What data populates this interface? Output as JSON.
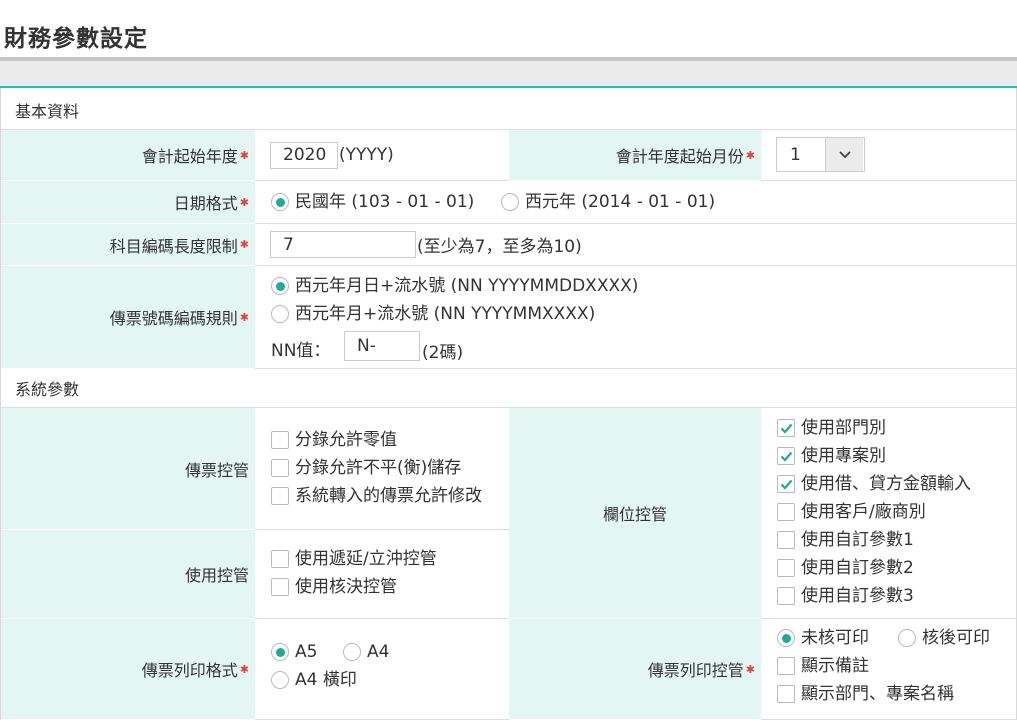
{
  "page_title": "財務參數設定",
  "sections": {
    "basic": "基本資料",
    "system": "系統參數"
  },
  "fiscal_start_year": {
    "label": "會計起始年度",
    "value": "2020",
    "suffix": "(YYYY)"
  },
  "fiscal_start_month": {
    "label": "會計年度起始月份",
    "value": "1"
  },
  "date_format": {
    "label": "日期格式",
    "opt1": "民國年 (103 - 01 - 01)",
    "opt2": "西元年 (2014 - 01 - 01)",
    "selected": "opt1"
  },
  "account_code_length": {
    "label": "科目編碼長度限制",
    "value": "7",
    "hint": "(至少為7，至多為10)"
  },
  "voucher_number_rule": {
    "label": "傳票號碼編碼規則",
    "opt1": "西元年月日+流水號 (NN YYYYMMDDXXXX)",
    "opt2": "西元年月+流水號 (NN YYYYMMXXXX)",
    "nn_label": "NN值：",
    "nn_value": "N-",
    "nn_hint": "(2碼)",
    "selected": "opt1"
  },
  "voucher_control": {
    "label": "傳票控管",
    "opt1": "分錄允許零值",
    "opt2": "分錄允許不平(衡)儲存",
    "opt3": "系統轉入的傳票允許修改"
  },
  "usage_control": {
    "label": "使用控管",
    "opt1": "使用遞延/立沖控管",
    "opt2": "使用核決控管"
  },
  "field_control": {
    "label": "欄位控管",
    "opt1": "使用部門別",
    "opt2": "使用專案別",
    "opt3": "使用借、貸方金額輸入",
    "opt4": "使用客戶/廠商別",
    "opt5": "使用自訂參數1",
    "opt6": "使用自訂參數2",
    "opt7": "使用自訂參數3",
    "checked": [
      true,
      true,
      true,
      false,
      false,
      false,
      false
    ]
  },
  "voucher_print_format": {
    "label": "傳票列印格式",
    "opt1": "A5",
    "opt2": "A4",
    "opt3": "A4 橫印",
    "selected": "opt1"
  },
  "voucher_print_control": {
    "label": "傳票列印控管",
    "opt1": "未核可印",
    "opt2": "核後可印",
    "opt3": "顯示備註",
    "opt4": "顯示部門、專案名稱",
    "selected": "opt1"
  },
  "colors": {
    "accent": "#1aae95",
    "label_bg": "#e3f6f1",
    "required": "#e2403d"
  },
  "required_mark": "✱"
}
